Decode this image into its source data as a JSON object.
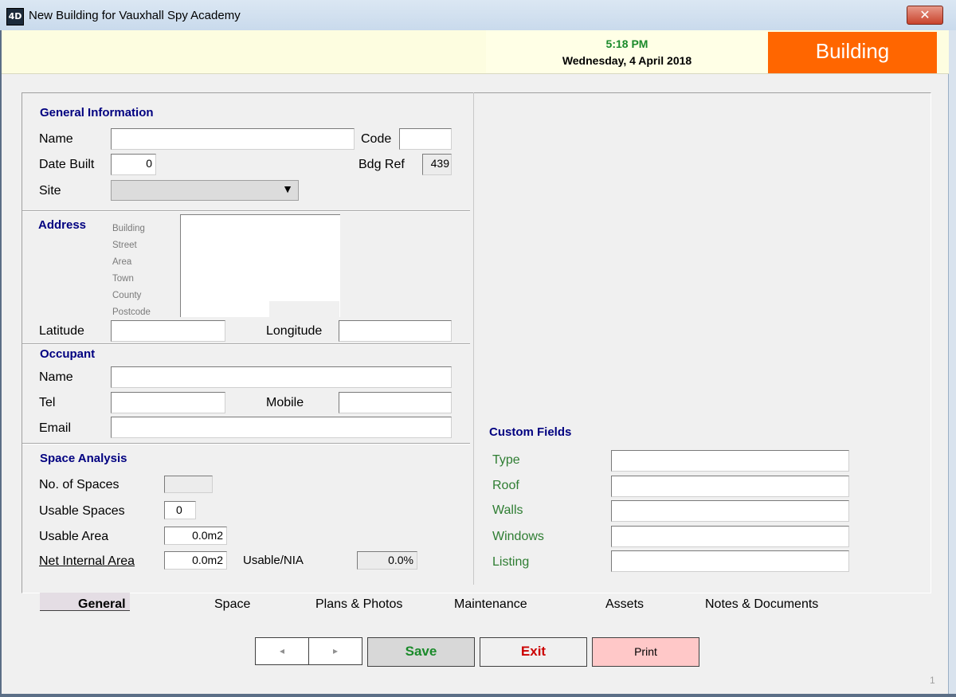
{
  "window": {
    "icon_text": "4D",
    "title": "New Building for Vauxhall  Spy Academy",
    "close_icon": "close-icon",
    "close_glyph": "✕"
  },
  "header": {
    "time": "5:18 PM",
    "date": "Wednesday, 4 April 2018",
    "module": "Building",
    "time_color": "#1a8a2a",
    "badge_color": "#ff6600"
  },
  "general": {
    "heading": "General Information",
    "name_label": "Name",
    "name_value": "",
    "code_label": "Code",
    "code_value": "",
    "date_built_label": "Date Built",
    "date_built_value": "0",
    "bdg_ref_label": "Bdg Ref",
    "bdg_ref_value": "439",
    "site_label": "Site",
    "site_value": ""
  },
  "address": {
    "heading": "Address",
    "lines": [
      "Building",
      "Street",
      "Area",
      "Town",
      "County",
      "Postcode"
    ],
    "latitude_label": "Latitude",
    "latitude_value": "",
    "longitude_label": "Longitude",
    "longitude_value": ""
  },
  "occupant": {
    "heading": "Occupant",
    "name_label": "Name",
    "tel_label": "Tel",
    "mobile_label": "Mobile",
    "email_label": "Email"
  },
  "space_analysis": {
    "heading": "Space Analysis",
    "spaces_label": "No. of  Spaces",
    "spaces_value": "",
    "usable_spaces_label": "Usable Spaces",
    "usable_spaces_value": "0",
    "usable_area_label": "Usable Area",
    "usable_area_value": "0.0m2",
    "nia_label": "Net Internal Area",
    "nia_value": "0.0m2",
    "ratio_label": "Usable/NIA",
    "ratio_value": "0.0%"
  },
  "custom_fields": {
    "heading": "Custom Fields",
    "fields": [
      {
        "label": "Type",
        "value": ""
      },
      {
        "label": "Roof",
        "value": ""
      },
      {
        "label": "Walls",
        "value": ""
      },
      {
        "label": "Windows",
        "value": ""
      },
      {
        "label": "Listing",
        "value": ""
      }
    ]
  },
  "tabs": [
    "General",
    "Space",
    "Plans & Photos",
    "Maintenance",
    "Assets",
    "Notes & Documents"
  ],
  "buttons": {
    "prev_glyph": "◂",
    "next_glyph": "▸",
    "save": "Save",
    "exit": "Exit",
    "print": "Print",
    "save_color": "#1a8a2a",
    "exit_color": "#cc0000",
    "print_bg": "#ffc8c8"
  },
  "page_number": "1"
}
